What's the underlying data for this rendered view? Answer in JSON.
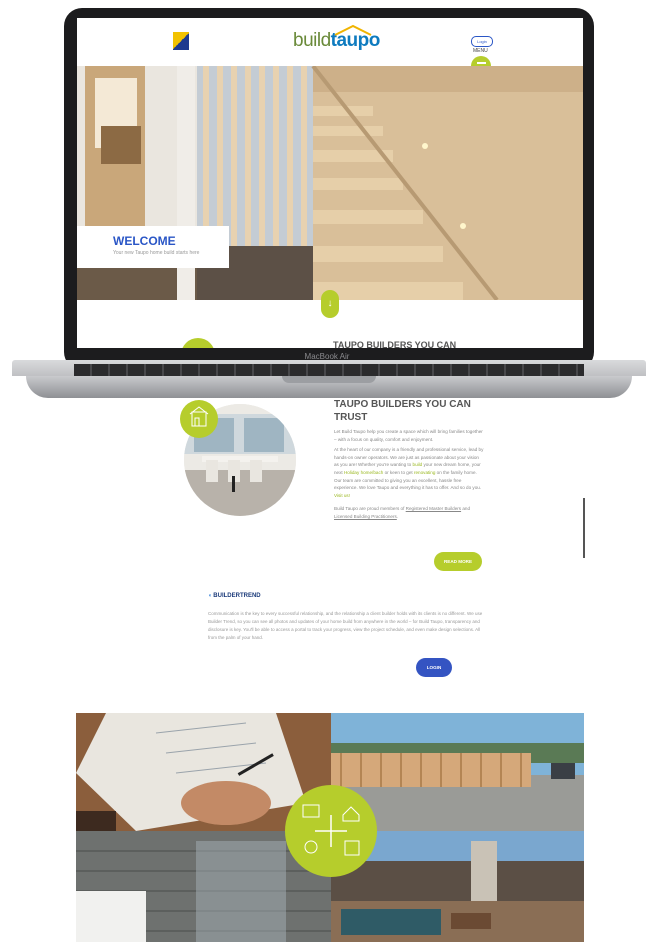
{
  "laptop": {
    "model": "MacBook Air"
  },
  "site": {
    "brand_light": "build",
    "brand_bold": "taupo",
    "menu_label": "MENU",
    "builder_badge": "Login",
    "colors": {
      "accent": "#b6cd2c",
      "primary": "#2a56c6",
      "brand_blue": "#0e7bbf"
    }
  },
  "hero": {
    "title": "WELCOME",
    "subtitle": "Your new Taupo home build starts here"
  },
  "about": {
    "title_cut": "TAUPO BUILDERS YOU CAN",
    "title": "TAUPO BUILDERS YOU CAN TRUST",
    "p1": "Let Build Taupo help you create a space which will bring families together – with a focus on quality, comfort and enjoyment.",
    "p2a": "At the heart of our company is a friendly and professional service, lead by hands-on owner operators. We are just as passionate about your vision as you are! Whether you're wanting to ",
    "p2_link1": "build",
    "p2b": " your new dream home, your next ",
    "p2_link2": "Holiday home/bach",
    "p2c": " or keen to get ",
    "p2_link3": "renovating",
    "p2d": " on the family home. Our team are committed to giving you an excellent, hassle free experience. We love Taupo and everything it has to offer. And so do you. ",
    "p2_link4": "Visit us!",
    "p3a": "Build Taupo are proud members of ",
    "p3_link1": "Registered Master Builders",
    "p3b": " and ",
    "p3_link2": "Licensed Building Practitioners",
    "p3c": ".",
    "read_more": "READ MORE"
  },
  "buildertrend": {
    "logo": "BUILDERTREND",
    "text": "Communication is the key to every successful relationship, and the relationship a client builder holds with its clients is no different. We use Builder Trend, so you can see all photos and updates of your home build from anywhere in the world – for Build Taupo, transparency and disclosure is key. You'll be able to access a portal to track your progress, view the project schedule, and even make design selections. All from the palm of your hand.",
    "login": "LOGIN"
  },
  "icons": [
    "menu-icon",
    "arrow-down-icon",
    "house-plan-icon",
    "plus-icon"
  ]
}
